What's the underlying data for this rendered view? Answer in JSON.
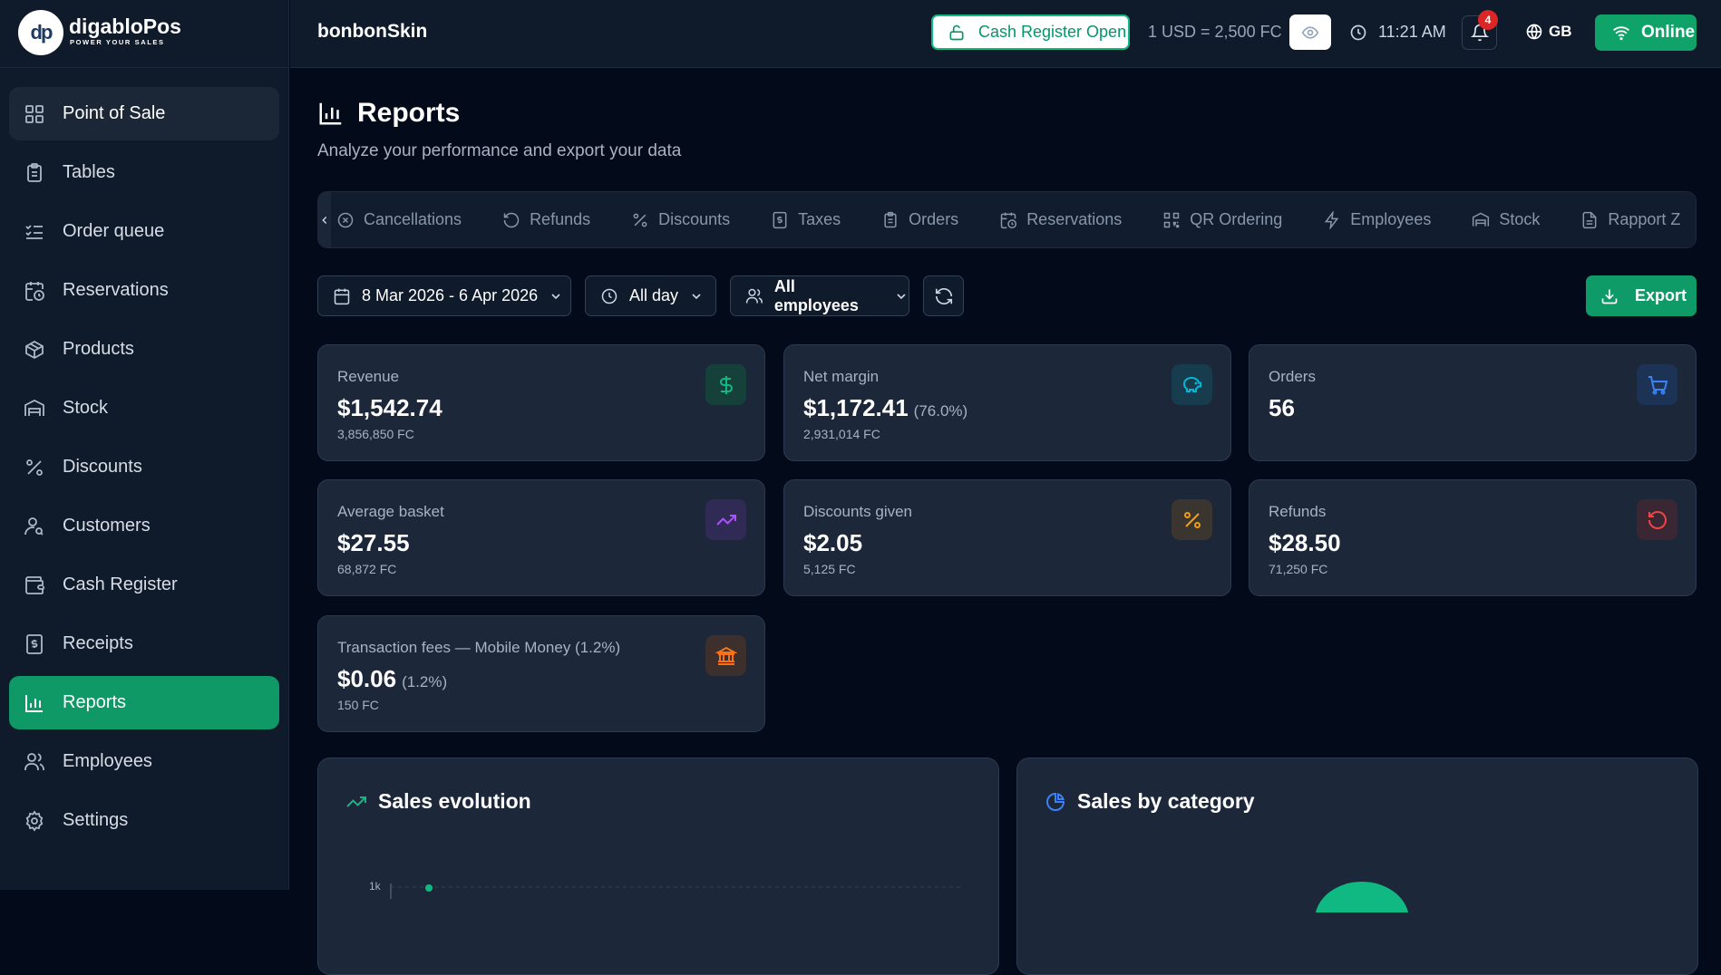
{
  "brand": {
    "mark": "dp",
    "name": "digabloPos",
    "tagline": "POWER YOUR SALES"
  },
  "sidebar": {
    "items": [
      {
        "label": "Point of Sale",
        "icon": "grid-icon",
        "state": "hover"
      },
      {
        "label": "Tables",
        "icon": "clipboard-icon"
      },
      {
        "label": "Order queue",
        "icon": "list-check-icon"
      },
      {
        "label": "Reservations",
        "icon": "calendar-clock-icon"
      },
      {
        "label": "Products",
        "icon": "box-icon"
      },
      {
        "label": "Stock",
        "icon": "warehouse-icon"
      },
      {
        "label": "Discounts",
        "icon": "percent-icon"
      },
      {
        "label": "Customers",
        "icon": "user-search-icon"
      },
      {
        "label": "Cash Register",
        "icon": "wallet-icon"
      },
      {
        "label": "Receipts",
        "icon": "receipt-icon"
      },
      {
        "label": "Reports",
        "icon": "bar-chart-icon",
        "state": "active"
      },
      {
        "label": "Employees",
        "icon": "users-icon"
      },
      {
        "label": "Settings",
        "icon": "gear-icon"
      }
    ]
  },
  "topbar": {
    "store_name": "bonbonSkin",
    "cash_register": "Cash Register Open",
    "exchange_rate": "1 USD = 2,500 FC",
    "time": "11:21 AM",
    "notifications": "4",
    "language": "GB",
    "status": "Online"
  },
  "page": {
    "title": "Reports",
    "subtitle": "Analyze your performance and export your data"
  },
  "tabs": [
    "Cancellations",
    "Refunds",
    "Discounts",
    "Taxes",
    "Orders",
    "Reservations",
    "QR Ordering",
    "Employees",
    "Stock",
    "Rapport Z"
  ],
  "filters": {
    "date_range": "8 Mar 2026 - 6 Apr 2026",
    "time": "All day",
    "employees": "All employees",
    "export": "Export"
  },
  "cards": [
    {
      "label": "Revenue",
      "value": "$1,542.74",
      "pct": "",
      "sub": "3,856,850 FC",
      "icon": "dollar-icon",
      "color": "#10b981",
      "bg": "#16413b"
    },
    {
      "label": "Net margin",
      "value": "$1,172.41",
      "pct": "(76.0%)",
      "sub": "2,931,014 FC",
      "icon": "piggy-bank-icon",
      "color": "#06b6d4",
      "bg": "#163c4d"
    },
    {
      "label": "Orders",
      "value": "56",
      "pct": "",
      "sub": "",
      "icon": "cart-icon",
      "color": "#3b82f6",
      "bg": "#1c3356"
    },
    {
      "label": "Average basket",
      "value": "$27.55",
      "pct": "",
      "sub": "68,872 FC",
      "icon": "trending-up-icon",
      "color": "#a855f7",
      "bg": "#302b55"
    },
    {
      "label": "Discounts given",
      "value": "$2.05",
      "pct": "",
      "sub": "5,125 FC",
      "icon": "percent-icon",
      "color": "#f59e0b",
      "bg": "#3b3530"
    },
    {
      "label": "Refunds",
      "value": "$28.50",
      "pct": "",
      "sub": "71,250 FC",
      "icon": "rotate-ccw-icon",
      "color": "#ef4444",
      "bg": "#3b2734"
    },
    {
      "label": "Transaction fees — Mobile Money (1.2%)",
      "value": "$0.06",
      "pct": "(1.2%)",
      "sub": "150 FC",
      "icon": "bank-icon",
      "color": "#f97316",
      "bg": "#3c2f2c"
    }
  ],
  "panels": {
    "sales_evolution": "Sales evolution",
    "sales_by_category": "Sales by category",
    "y_tick_top": "1k"
  }
}
